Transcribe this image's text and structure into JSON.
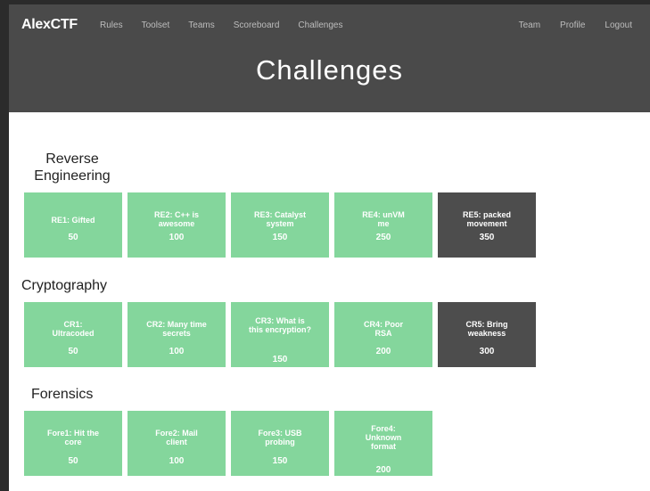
{
  "nav": {
    "brand": "AlexCTF",
    "left": [
      "Rules",
      "Toolset",
      "Teams",
      "Scoreboard",
      "Challenges"
    ],
    "right": [
      "Team",
      "Profile",
      "Logout"
    ]
  },
  "page_title": "Challenges",
  "categories": [
    {
      "title": "Reverse Engineering",
      "challenges": [
        {
          "name": "RE1: Gifted",
          "points": "50",
          "solved": false
        },
        {
          "name": "RE2: C++ is awesome",
          "points": "100",
          "solved": false
        },
        {
          "name": "RE3: Catalyst system",
          "points": "150",
          "solved": false
        },
        {
          "name": "RE4: unVM me",
          "points": "250",
          "solved": false
        },
        {
          "name": "RE5: packed movement",
          "points": "350",
          "solved": true
        }
      ]
    },
    {
      "title": "Cryptography",
      "challenges": [
        {
          "name": "CR1: Ultracoded",
          "points": "50",
          "solved": false
        },
        {
          "name": "CR2: Many time secrets",
          "points": "100",
          "solved": false
        },
        {
          "name": "CR3: What is this encryption?",
          "points": "150",
          "solved": false
        },
        {
          "name": "CR4: Poor RSA",
          "points": "200",
          "solved": false
        },
        {
          "name": "CR5: Bring weakness",
          "points": "300",
          "solved": true
        }
      ]
    },
    {
      "title": "Forensics",
      "challenges": [
        {
          "name": "Fore1: Hit the core",
          "points": "50",
          "solved": false
        },
        {
          "name": "Fore2: Mail client",
          "points": "100",
          "solved": false
        },
        {
          "name": "Fore3: USB probing",
          "points": "150",
          "solved": false
        },
        {
          "name": "Fore4: Unknown format",
          "points": "200",
          "solved": false
        }
      ]
    }
  ],
  "colors": {
    "header_bg": "#4a4a4a",
    "tile_unsolved": "#84d69c",
    "tile_solved": "#4d4d4d"
  }
}
